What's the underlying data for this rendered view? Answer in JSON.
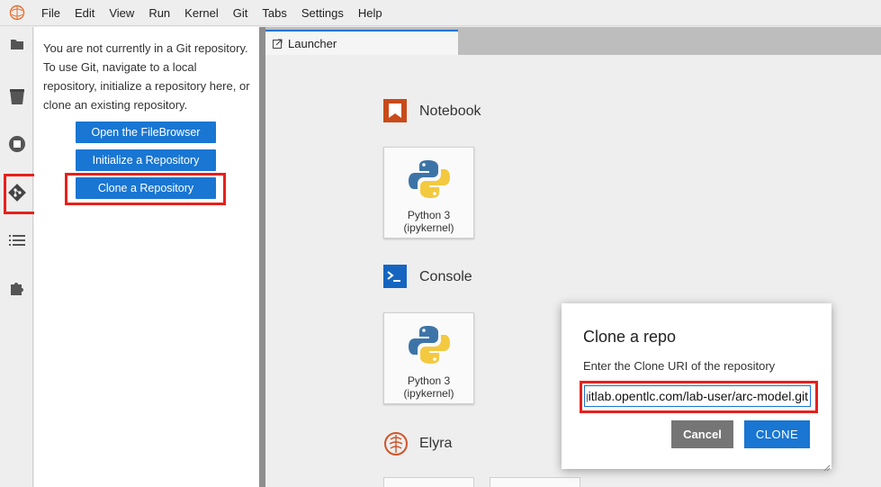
{
  "menubar": {
    "items": [
      "File",
      "Edit",
      "View",
      "Run",
      "Kernel",
      "Git",
      "Tabs",
      "Settings",
      "Help"
    ]
  },
  "activitybar": {
    "icons": [
      "folder-icon",
      "trash-icon",
      "stop-icon",
      "git-icon",
      "list-icon",
      "puzzle-icon"
    ]
  },
  "git_panel": {
    "message": "You are not currently in a Git repository. To use Git, navigate to a local repository, initialize a repository here, or clone an existing repository.",
    "open_filebrowser": "Open the FileBrowser",
    "init_repo": "Initialize a Repository",
    "clone_repo": "Clone a Repository"
  },
  "tab": {
    "label": "Launcher"
  },
  "launcher": {
    "notebook_title": "Notebook",
    "console_title": "Console",
    "elyra_title": "Elyra",
    "notebook_card": {
      "line1": "Python 3",
      "line2": "(ipykernel)"
    },
    "console_card": {
      "line1": "Python 3",
      "line2": "(ipykernel)"
    }
  },
  "dialog": {
    "title": "Clone a repo",
    "label": "Enter the Clone URI of the repository",
    "input_value": "https://gitlab.opentlc.com/lab-user/arc-model.git",
    "cancel": "Cancel",
    "clone": "CLONE"
  },
  "colors": {
    "accent": "#1976d2",
    "highlight": "#e8201a",
    "notebook_icon": "#c94a1a",
    "console_icon": "#1565c0"
  }
}
